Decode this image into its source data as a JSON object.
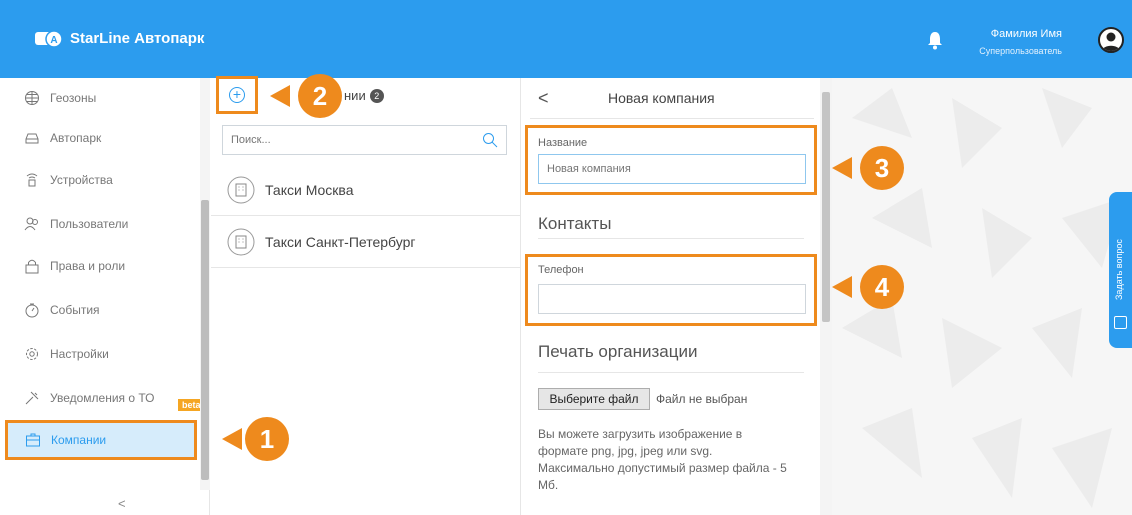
{
  "app": {
    "brand": "StarLine Автопарк"
  },
  "user": {
    "name": "Фамилия Имя",
    "role": "Суперпользователь"
  },
  "sidebar": {
    "items": [
      {
        "label": "Геозоны",
        "icon": "globe-icon"
      },
      {
        "label": "Автопарк",
        "icon": "car-icon"
      },
      {
        "label": "Устройства",
        "icon": "device-icon"
      },
      {
        "label": "Пользователи",
        "icon": "users-icon"
      },
      {
        "label": "Права и роли",
        "icon": "lock-icon"
      },
      {
        "label": "События",
        "icon": "events-icon"
      },
      {
        "label": "Настройки",
        "icon": "gear-icon"
      },
      {
        "label": "Уведомления о ТО",
        "icon": "wrench-icon",
        "badge": "beta"
      },
      {
        "label": "Компании",
        "icon": "company-icon",
        "active": true
      }
    ],
    "collapse": "<"
  },
  "companies": {
    "title": "Компании",
    "title_visible": "нии",
    "count": "2",
    "search_placeholder": "Поиск...",
    "items": [
      {
        "name": "Такси Москва"
      },
      {
        "name": "Такси Санкт-Петербург"
      }
    ]
  },
  "form": {
    "title": "Новая компания",
    "name_label": "Название",
    "name_placeholder": "Новая компания",
    "contacts_title": "Контакты",
    "phone_label": "Телефон",
    "phone_value": "",
    "print_title": "Печать организации",
    "file_button": "Выберите файл",
    "file_status": "Файл не выбран",
    "hint": "Вы можете загрузить изображение в формате png, jpg, jpeg или svg. Максимально допустимый размер файла - 5 Мб."
  },
  "help_tab": "Задать вопрос",
  "callouts": [
    "1",
    "2",
    "3",
    "4"
  ],
  "colors": {
    "header": "#2c9cee",
    "accent": "#ee8a1d",
    "active_bg": "#d6ecfb"
  }
}
